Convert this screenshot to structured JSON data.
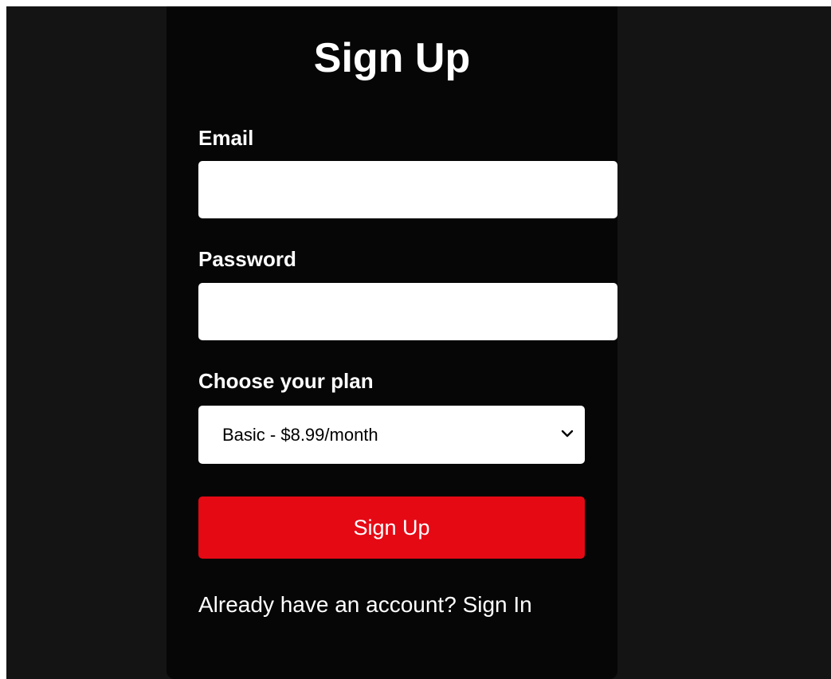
{
  "form": {
    "title": "Sign Up",
    "email": {
      "label": "Email",
      "value": "",
      "placeholder": ""
    },
    "password": {
      "label": "Password",
      "value": "",
      "placeholder": ""
    },
    "plan": {
      "label": "Choose your plan",
      "selected": "Basic - $8.99/month"
    },
    "submit_label": "Sign Up",
    "footer": {
      "prompt": "Already have an account? ",
      "link": "Sign In"
    }
  },
  "colors": {
    "page_background": "#141414",
    "card_background": "#060606",
    "accent": "#e50914",
    "text": "#ffffff"
  },
  "icons": {
    "select_arrow": "chevron-down-icon"
  }
}
